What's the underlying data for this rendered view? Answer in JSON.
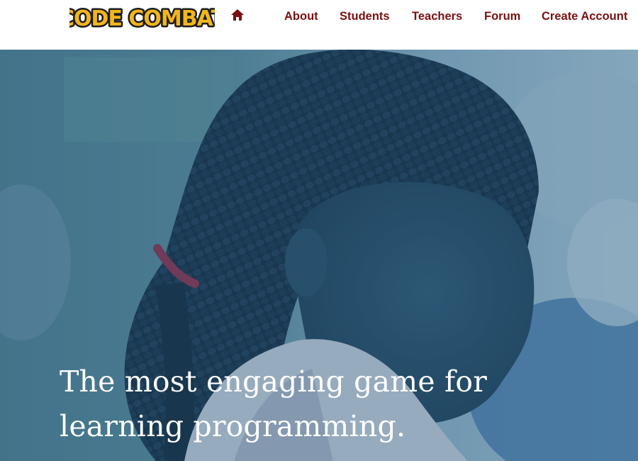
{
  "brand": {
    "logo_text": "CODE COMBAT",
    "logo_colors": {
      "fill": "#f2b61c",
      "outline": "#1c1c1c",
      "highlight": "#ffe066"
    }
  },
  "nav": {
    "home_icon": "home-icon",
    "items": [
      {
        "label": "About"
      },
      {
        "label": "Students"
      },
      {
        "label": "Teachers"
      },
      {
        "label": "Forum"
      },
      {
        "label": "Create Account"
      }
    ],
    "link_color": "#7a1010"
  },
  "hero": {
    "headline_line1": "The most engaging game for",
    "headline_line2": "learning programming.",
    "overlay_color": "#3f6a8a"
  }
}
